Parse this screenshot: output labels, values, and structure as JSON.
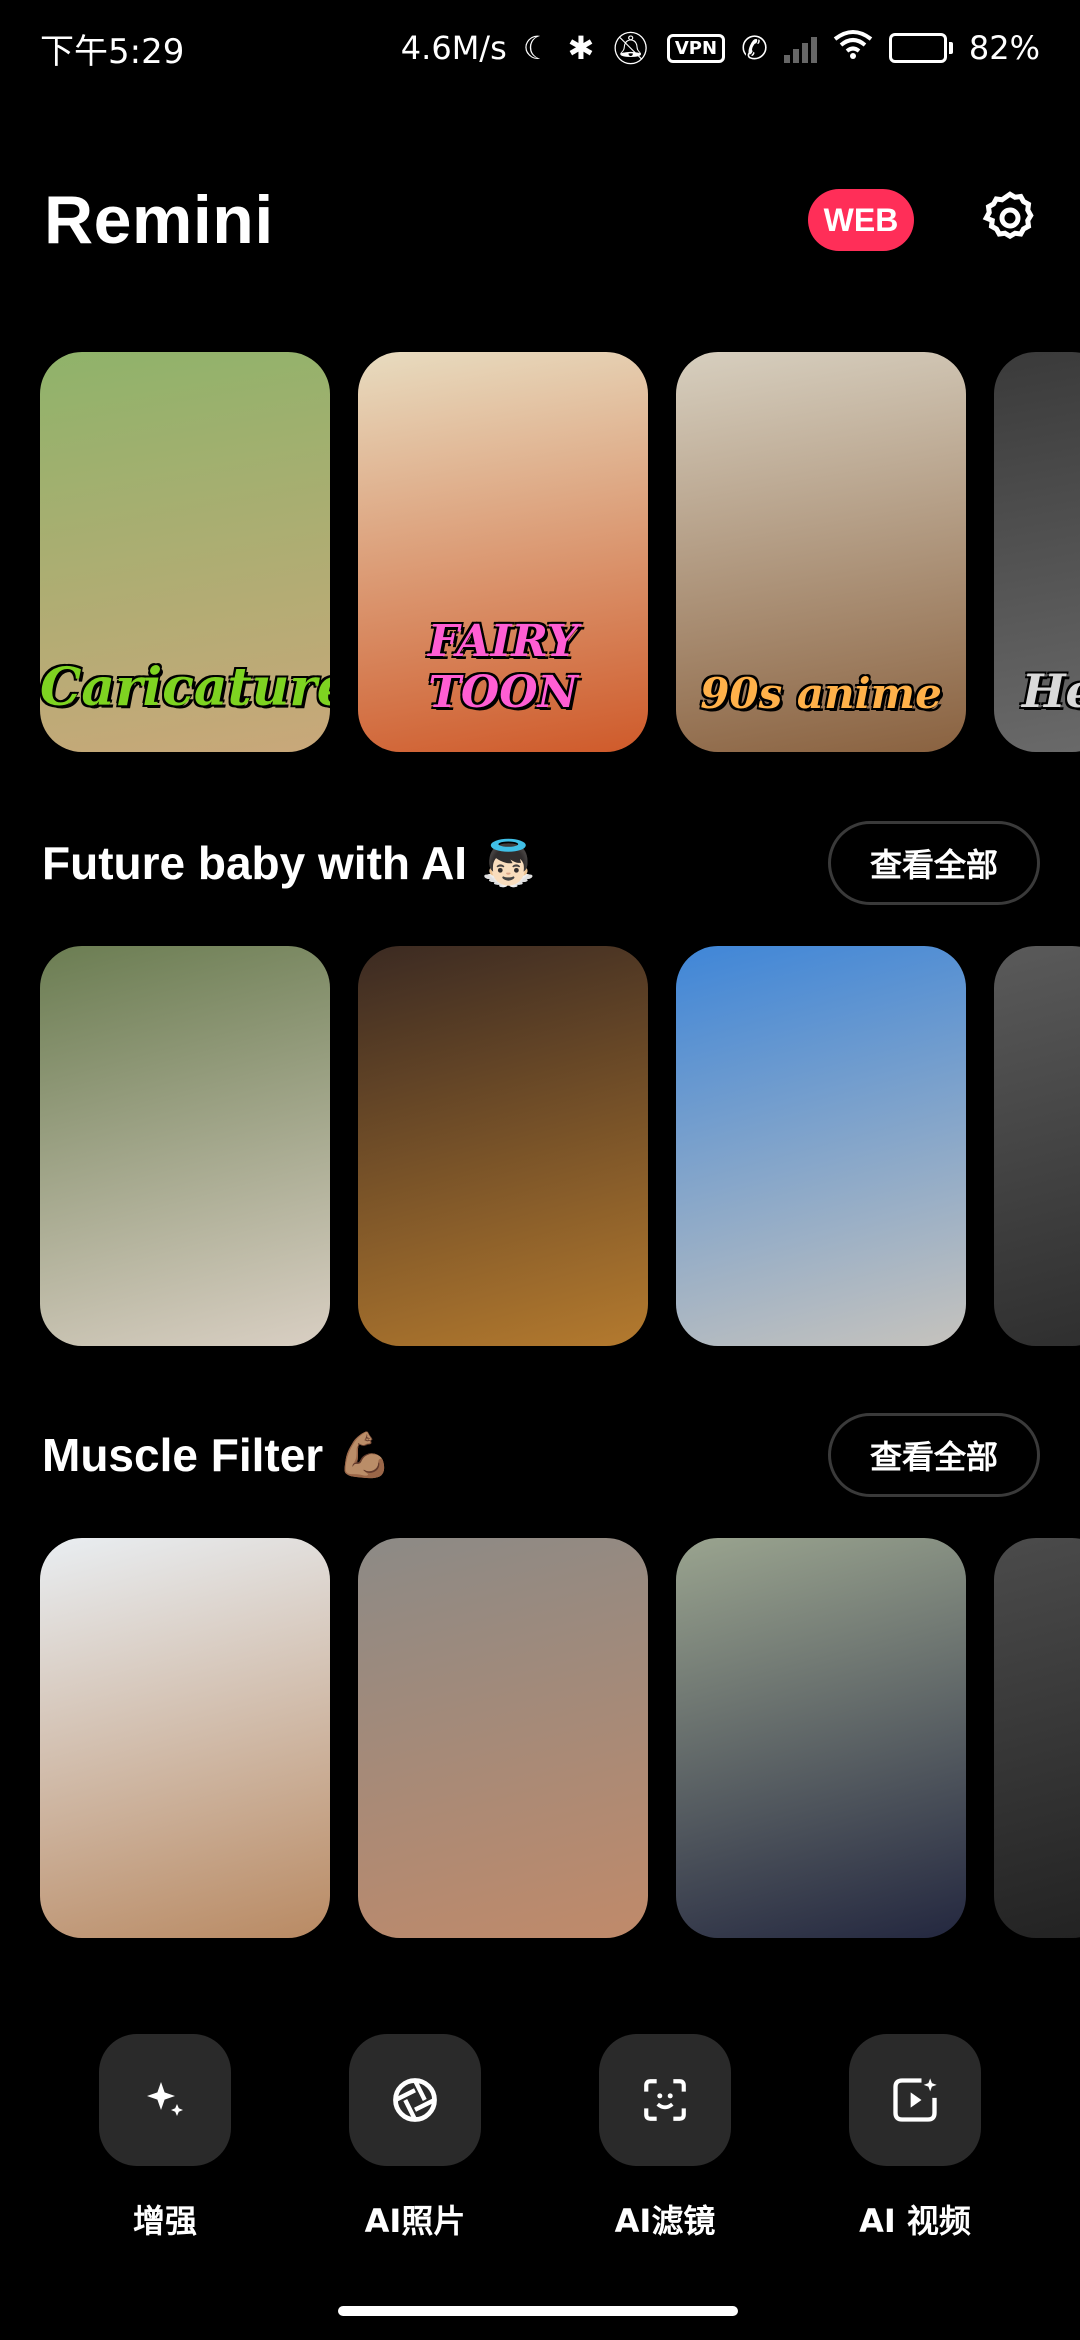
{
  "status_bar": {
    "time": "下午5:29",
    "net_speed": "4.6M/s",
    "vpn": "VPN",
    "battery": "82%",
    "battery_level": 0.82
  },
  "header": {
    "title": "Remini",
    "web_badge": "WEB",
    "settings_icon": "gear-icon"
  },
  "styles_row": {
    "cards": [
      {
        "label": "Caricature",
        "color": "#7ed321",
        "bg1": "#8fb36a",
        "bg2": "#c9a87a"
      },
      {
        "label": "FAIRY TOON",
        "color": "#ff5ed3",
        "bg1": "#e8dcc0",
        "bg2": "#cf5a2a"
      },
      {
        "label": "90s anime",
        "color": "#ffb14a",
        "bg1": "#d7cfbf",
        "bg2": "#8a6240"
      },
      {
        "label": "He",
        "color": "#d9d9d9",
        "bg1": "#3a3a3a",
        "bg2": "#6a6a6a"
      }
    ]
  },
  "sections": [
    {
      "title": "Future baby with AI",
      "emoji": "👼🏻",
      "see_all": "查看全部",
      "cards": [
        {
          "bg1": "#6b7d52",
          "bg2": "#d9cfc3"
        },
        {
          "bg1": "#3b2a22",
          "bg2": "#b47a2e"
        },
        {
          "bg1": "#3f86d8",
          "bg2": "#c6c3bd"
        },
        {
          "bg1": "#5a5a5a",
          "bg2": "#2e2e2e"
        }
      ]
    },
    {
      "title": "Muscle Filter",
      "emoji": "💪🏽",
      "see_all": "查看全部",
      "cards": [
        {
          "bg1": "#e9eef2",
          "bg2": "#b98a63"
        },
        {
          "bg1": "#8c8a86",
          "bg2": "#c08a6a"
        },
        {
          "bg1": "#9aa48f",
          "bg2": "#23273f"
        },
        {
          "bg1": "#4b4b4b",
          "bg2": "#222222"
        }
      ]
    }
  ],
  "bottom_nav": [
    {
      "label": "增强",
      "icon": "sparkle-icon"
    },
    {
      "label": "AI照片",
      "icon": "aperture-icon"
    },
    {
      "label": "AI滤镜",
      "icon": "face-scan-icon"
    },
    {
      "label": "AI 视频",
      "icon": "video-sparkle-icon"
    }
  ]
}
